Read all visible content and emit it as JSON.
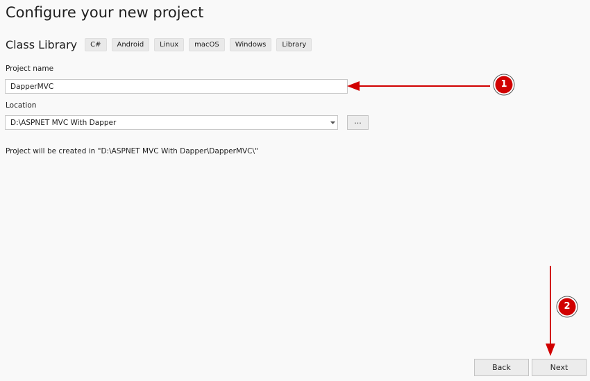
{
  "page": {
    "title": "Configure your new project"
  },
  "template": {
    "name": "Class Library",
    "tags": [
      "C#",
      "Android",
      "Linux",
      "macOS",
      "Windows",
      "Library"
    ]
  },
  "project_name": {
    "label": "Project name",
    "value": "DapperMVC"
  },
  "location": {
    "label": "Location",
    "value": "D:\\ASPNET MVC With Dapper",
    "browse_label": "..."
  },
  "info": {
    "path_text": "Project will be created in \"D:\\ASPNET MVC With Dapper\\DapperMVC\\\""
  },
  "footer": {
    "back_label": "Back",
    "next_label": "Next"
  },
  "annotations": {
    "color": "#d10000",
    "markers": [
      {
        "label": "1"
      },
      {
        "label": "2"
      }
    ]
  }
}
